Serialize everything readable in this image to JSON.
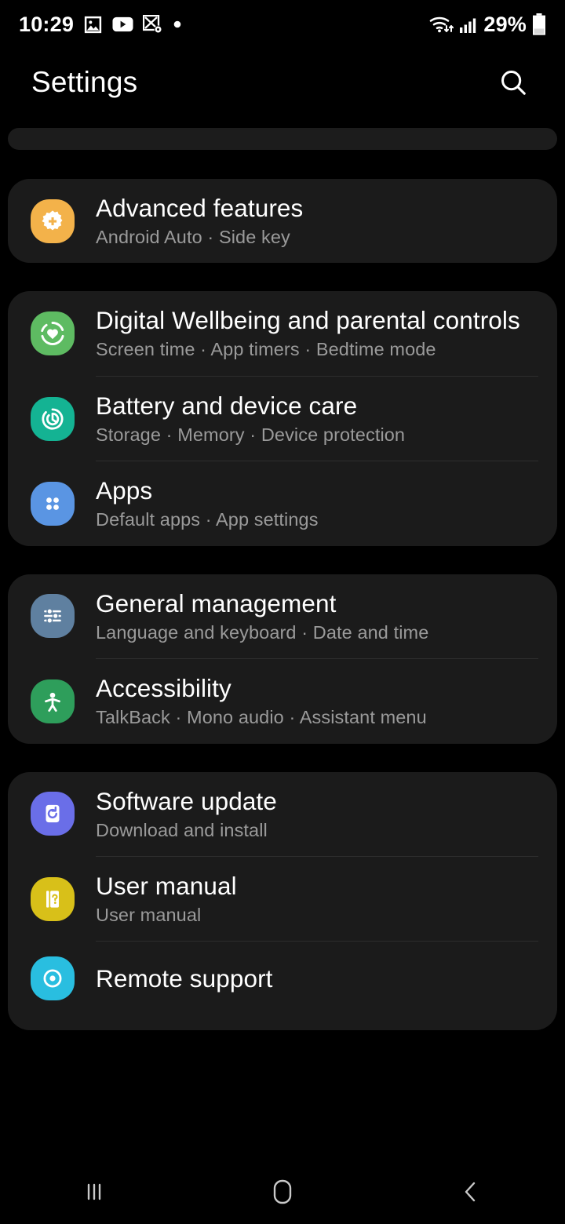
{
  "statusbar": {
    "clock": "10:29",
    "battery_percent": "29%",
    "icons": [
      "gallery-icon",
      "youtube-icon",
      "photo-editor-icon",
      "dot-icon"
    ],
    "right_icons": [
      "wifi-icon",
      "signal-icon",
      "battery-icon"
    ]
  },
  "header": {
    "title": "Settings",
    "search_icon": "search-icon"
  },
  "cards": [
    {
      "id": "card-advanced",
      "rows": [
        {
          "name": "advanced-features",
          "title": "Advanced features",
          "subtitle": "Android Auto  ·  Side key",
          "icon": "gear-plus-icon",
          "icon_bg": "#F3B24A"
        }
      ]
    },
    {
      "id": "card-wellbeing",
      "rows": [
        {
          "name": "digital-wellbeing",
          "title": "Digital Wellbeing and parental controls",
          "subtitle": "Screen time  ·  App timers  ·  Bedtime mode",
          "icon": "heart-circle-icon",
          "icon_bg": "#5EBB62"
        },
        {
          "name": "battery-device-care",
          "title": "Battery and device care",
          "subtitle": "Storage  ·  Memory  ·  Device protection",
          "icon": "device-care-icon",
          "icon_bg": "#14B393"
        },
        {
          "name": "apps",
          "title": "Apps",
          "subtitle": "Default apps  ·  App settings",
          "icon": "four-dots-icon",
          "icon_bg": "#5A95E3"
        }
      ]
    },
    {
      "id": "card-general",
      "rows": [
        {
          "name": "general-management",
          "title": "General management",
          "subtitle": "Language and keyboard  ·  Date and time",
          "icon": "sliders-icon",
          "icon_bg": "#5F80A0"
        },
        {
          "name": "accessibility",
          "title": "Accessibility",
          "subtitle": "TalkBack  ·  Mono audio  ·  Assistant menu",
          "icon": "accessibility-person-icon",
          "icon_bg": "#2E9E5B"
        }
      ]
    },
    {
      "id": "card-support",
      "rows": [
        {
          "name": "software-update",
          "title": "Software update",
          "subtitle": "Download and install",
          "icon": "software-update-icon",
          "icon_bg": "#6A6EE8"
        },
        {
          "name": "user-manual",
          "title": "User manual",
          "subtitle": "User manual",
          "icon": "book-question-icon",
          "icon_bg": "#D8C019"
        },
        {
          "name": "remote-support",
          "title": "Remote support",
          "subtitle": "",
          "icon": "remote-support-icon",
          "icon_bg": "#29BEE0"
        }
      ]
    }
  ],
  "navbar": {
    "recents_label": "recents-icon",
    "home_label": "home-icon",
    "back_label": "back-icon"
  }
}
